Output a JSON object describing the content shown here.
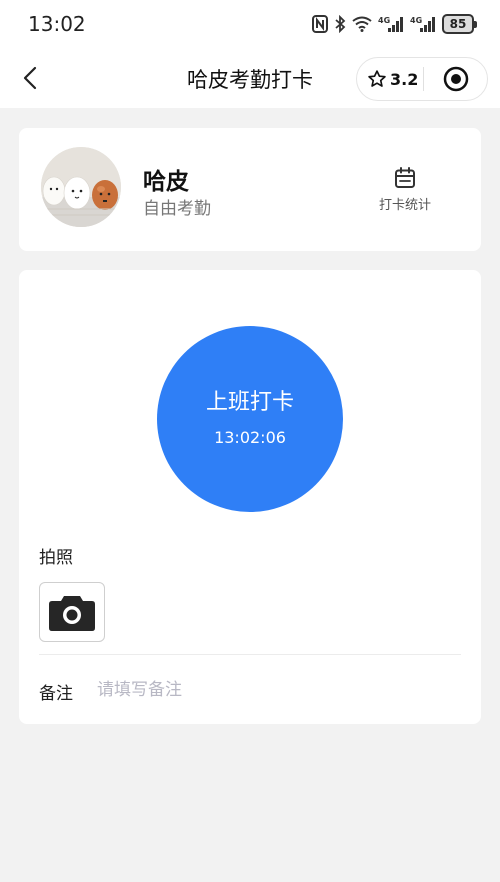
{
  "status_bar": {
    "time": "13:02",
    "battery": "85",
    "signal_1": "4G",
    "signal_2": "4G"
  },
  "nav": {
    "title": "哈皮考勤打卡",
    "rating": "3.2",
    "back_icon": "chevron-left-icon",
    "rating_icon": "star-outline-icon",
    "target_icon": "target-circle-icon"
  },
  "profile": {
    "name": "哈皮",
    "subtitle": "自由考勤",
    "stats_label": "打卡统计",
    "stats_icon": "calendar-icon"
  },
  "clock": {
    "label": "上班打卡",
    "time": "13:02:06",
    "color": "#2f7ff6"
  },
  "photo": {
    "label": "拍照",
    "icon": "camera-icon"
  },
  "remark": {
    "label": "备注",
    "placeholder": "请填写备注",
    "value": ""
  }
}
